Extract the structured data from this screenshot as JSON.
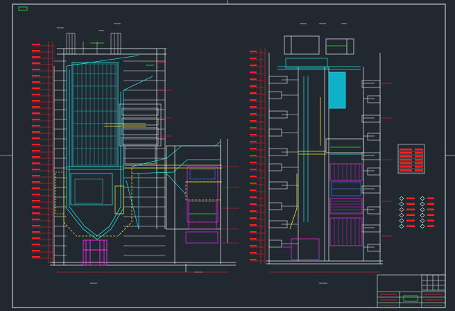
{
  "drawing": {
    "background": "#212830",
    "colors": {
      "frame": "#e8e8e8",
      "red": "#ff2020",
      "cyan": "#28e0e8",
      "yellow": "#f0e820",
      "magenta": "#ff28ff",
      "white": "#f0f0f0",
      "green": "#30e040",
      "blue": "#3070ff",
      "teal_fill": "#10b0c8"
    },
    "corner_tag": "",
    "title_block_text": "",
    "legend_table_text": ""
  }
}
